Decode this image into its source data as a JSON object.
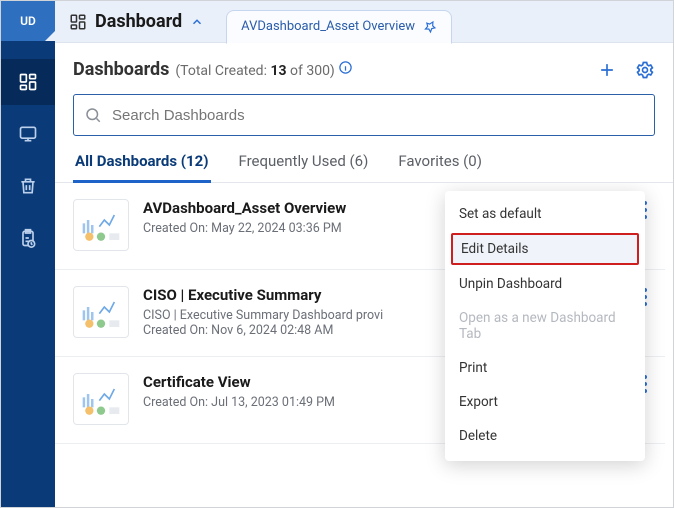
{
  "avatar": "UD",
  "titlebar": {
    "title": "Dashboard"
  },
  "tab": {
    "label": "AVDashboard_Asset Overview"
  },
  "subheader": {
    "heading": "Dashboards",
    "total_prefix": "(Total Created: ",
    "count": "13",
    "of_text": " of 300)"
  },
  "search": {
    "placeholder": "Search Dashboards"
  },
  "tabs": [
    {
      "label": "All Dashboards (12)",
      "active": true
    },
    {
      "label": "Frequently Used (6)",
      "active": false
    },
    {
      "label": "Favorites (0)",
      "active": false
    }
  ],
  "items": [
    {
      "name": "AVDashboard_Asset Overview",
      "subtitle": "",
      "created": "Created On: May 22, 2024 03:36 PM"
    },
    {
      "name": "CISO | Executive Summary",
      "subtitle": "CISO | Executive Summary Dashboard provi",
      "created": "Created On: Nov 6, 2024 02:48 AM"
    },
    {
      "name": "Certificate View",
      "subtitle": "",
      "created": "Created On: Jul 13, 2023 01:49 PM"
    }
  ],
  "menu": {
    "set_default": "Set as default",
    "edit_details": "Edit Details",
    "unpin": "Unpin Dashboard",
    "open_new_tab": "Open as a new Dashboard Tab",
    "print": "Print",
    "export": "Export",
    "delete": "Delete"
  }
}
